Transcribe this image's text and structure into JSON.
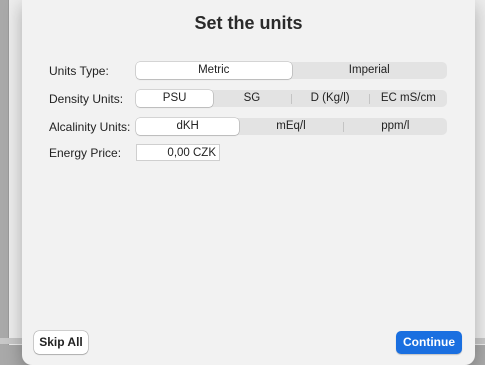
{
  "dialog": {
    "title": "Set the units"
  },
  "units_type": {
    "label": "Units Type:",
    "options": [
      "Metric",
      "Imperial"
    ],
    "selected": "Metric"
  },
  "density_units": {
    "label": "Density Units:",
    "options": [
      "PSU",
      "SG",
      "D (Kg/l)",
      "EC mS/cm"
    ],
    "selected": "PSU"
  },
  "alcalinity_units": {
    "label": "Alcalinity Units:",
    "options": [
      "dKH",
      "mEq/l",
      "ppm/l"
    ],
    "selected": "dKH"
  },
  "energy_price": {
    "label": "Energy Price:",
    "value": "0,00 CZK"
  },
  "buttons": {
    "skip_all": "Skip All",
    "continue": "Continue"
  },
  "colors": {
    "accent": "#1a6fe0",
    "sheet_background": "#f2f2f2",
    "segment_background": "#e3e3e3"
  }
}
